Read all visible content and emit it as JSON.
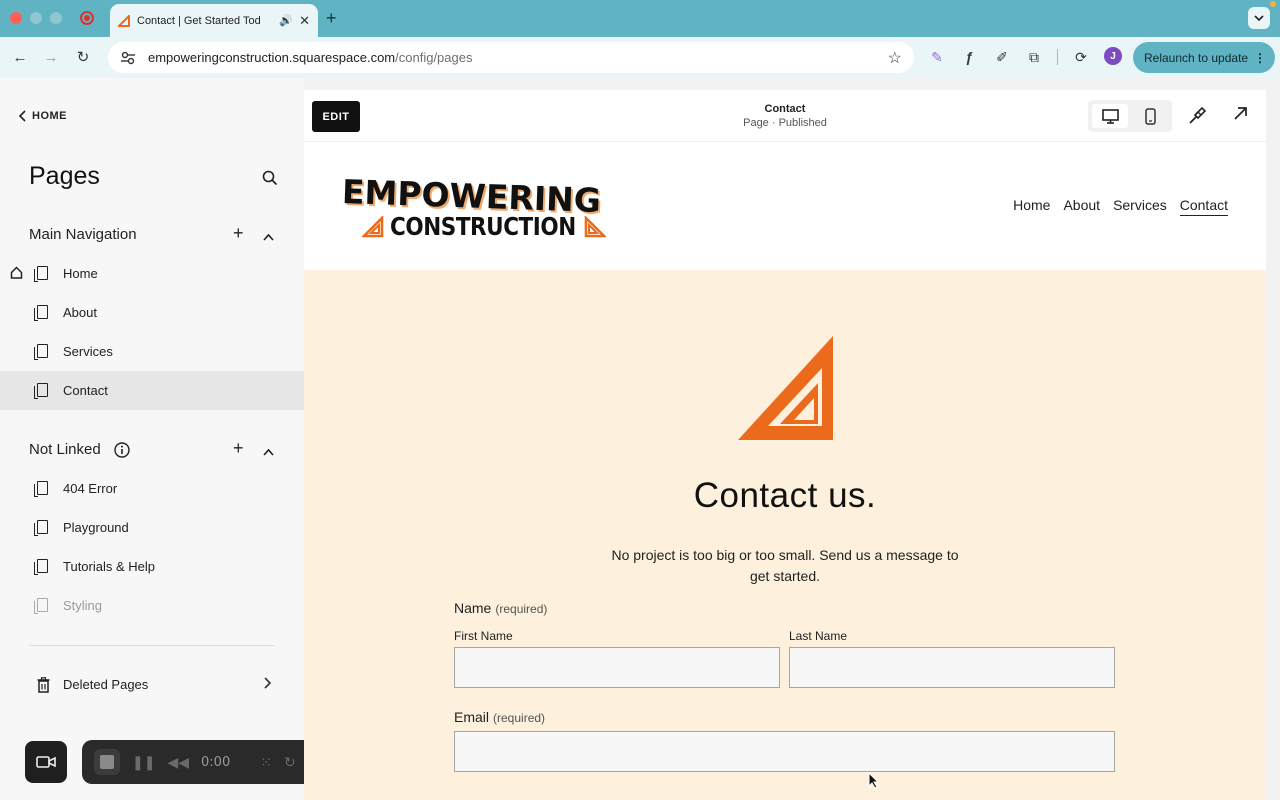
{
  "browser": {
    "tab_title": "Contact | Get Started Tod",
    "url_host": "empoweringconstruction.squarespace.com",
    "url_path": "/config/pages",
    "profile_initial": "J",
    "relaunch_label": "Relaunch to update"
  },
  "sidebar": {
    "home_link": "HOME",
    "title": "Pages",
    "main_nav": {
      "heading": "Main Navigation",
      "items": [
        {
          "label": "Home"
        },
        {
          "label": "About"
        },
        {
          "label": "Services"
        },
        {
          "label": "Contact"
        }
      ]
    },
    "not_linked": {
      "heading": "Not Linked",
      "items": [
        {
          "label": "404 Error"
        },
        {
          "label": "Playground"
        },
        {
          "label": "Tutorials & Help"
        },
        {
          "label": "Styling"
        }
      ]
    },
    "deleted_pages": "Deleted Pages"
  },
  "recorder": {
    "time": "0:00"
  },
  "preview": {
    "edit_label": "EDIT",
    "page_name": "Contact",
    "page_status": "Page · Published"
  },
  "site": {
    "logo_top": "EMPOWERING",
    "logo_bottom": "CONSTRUCTION",
    "nav": [
      "Home",
      "About",
      "Services",
      "Contact"
    ],
    "contact_title": "Contact us.",
    "contact_sub": "No project is too big or too small. Send us a message to get started.",
    "form": {
      "name_label": "Name",
      "required": "(required)",
      "first_name": "First Name",
      "last_name": "Last Name",
      "email_label": "Email"
    }
  },
  "colors": {
    "brand_orange": "#ec6a1c",
    "accent_teal": "#5fb3c2",
    "site_bg": "#fdf0dc"
  }
}
